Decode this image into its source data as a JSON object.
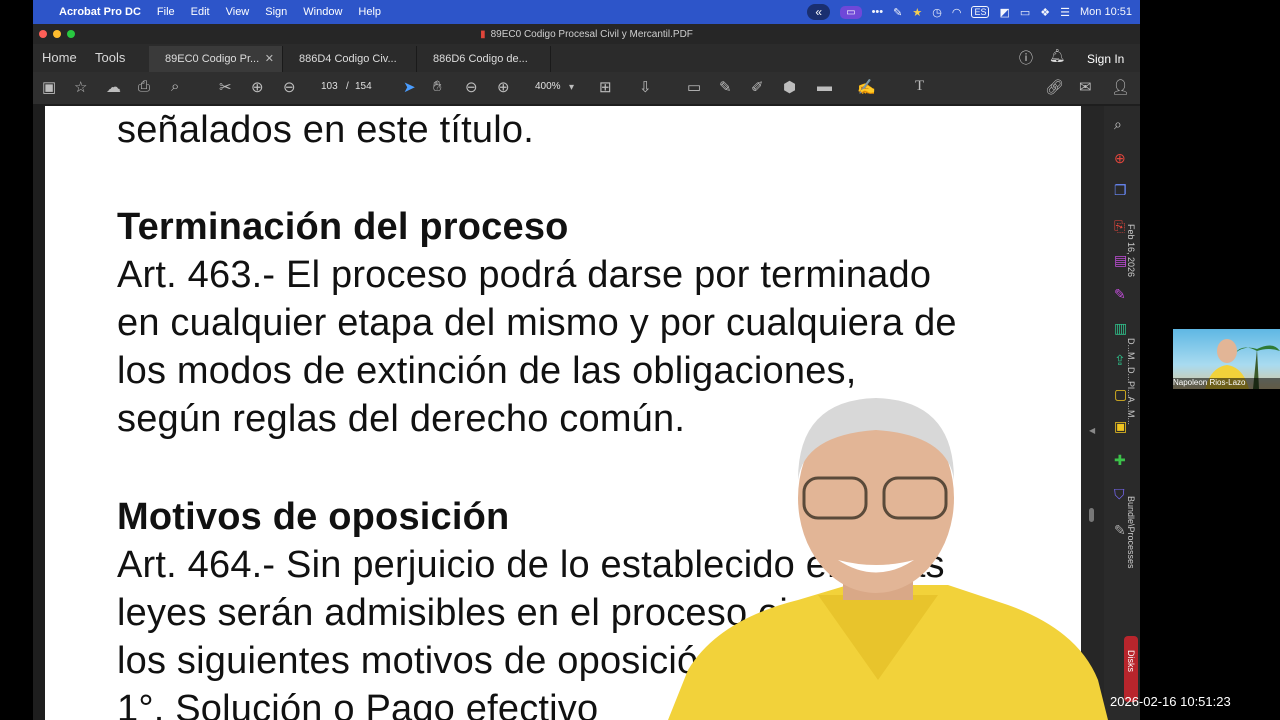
{
  "menubar": {
    "app_name": "Acrobat Pro DC",
    "items": [
      "File",
      "Edit",
      "View",
      "Sign",
      "Window",
      "Help"
    ],
    "input_source": "ES",
    "clock": "Mon 10:51"
  },
  "window": {
    "title": "89EC0 Codigo Procesal Civil y Mercantil.PDF",
    "nav": {
      "home": "Home",
      "tools": "Tools"
    },
    "tabs": [
      {
        "label": "89EC0 Codigo Pr...",
        "active": true
      },
      {
        "label": "886D4 Codigo Civ...",
        "active": false
      },
      {
        "label": "886D6 Codigo de...",
        "active": false
      }
    ],
    "sign_in": "Sign In"
  },
  "toolbar": {
    "page_current": "103",
    "page_separator": "/",
    "page_total": "154",
    "zoom": "400%"
  },
  "document": {
    "lines": [
      {
        "text": "señalados en este título.",
        "bold": false
      },
      {
        "text": "Terminación del proceso",
        "bold": true
      },
      {
        "text": "Art. 463.- El proceso podrá darse por terminado",
        "bold": false
      },
      {
        "text": "en cualquier etapa del mismo y por cualquiera de",
        "bold": false
      },
      {
        "text": "los modos de extinción de las obligaciones,",
        "bold": false
      },
      {
        "text": "según reglas del derecho común.",
        "bold": false
      },
      {
        "text": "Motivos de oposición",
        "bold": true
      },
      {
        "text": "Art. 464.- Sin perjuicio de lo establecido en otras",
        "bold": false
      },
      {
        "text": "leyes serán admisibles en el proceso ejecutivo",
        "bold": false
      },
      {
        "text": "los siguientes motivos de oposición:",
        "bold": false
      },
      {
        "text": "1°. Solución o Pago efectivo",
        "bold": false
      }
    ]
  },
  "side_panel": {
    "date_label": "Feb 16, 2026",
    "stack_label": "D...M...D...Pl...A...M...",
    "bundle_label": "Bundle\\Processes",
    "disks_label": "Disks"
  },
  "video": {
    "participant_name": "Napoleon Rios-Lazo",
    "timestamp": "2026-02-16  10:51:23"
  },
  "colors": {
    "menubar": "#2d55c9",
    "app_chrome": "#2f2f2f",
    "page": "#ffffff",
    "disks_button": "#b8252c",
    "shirt": "#f2d23a"
  }
}
